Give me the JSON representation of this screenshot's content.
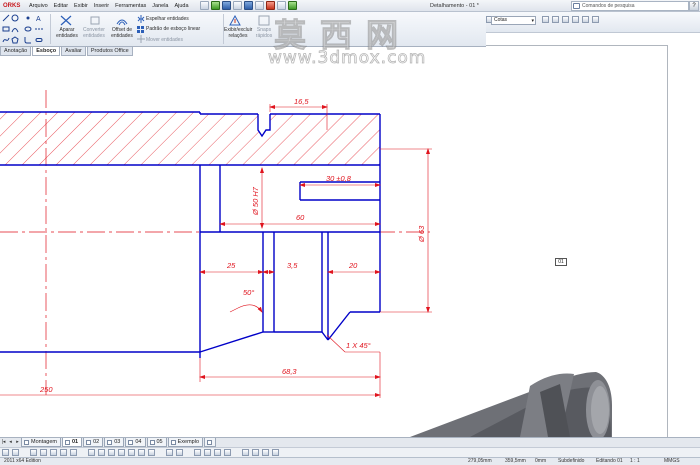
{
  "app": {
    "logo_text": "ORKS",
    "menu": [
      "Arquivo",
      "Editar",
      "Exibir",
      "Inserir",
      "Ferramentas",
      "Janela",
      "Ajuda"
    ],
    "window_title": "Detalhamento - 01 *",
    "search_placeholder": "Comandos de pesquisa",
    "search_go": "?"
  },
  "ribbon": {
    "aparar": "Aparar entidades",
    "converter": "Converter entidades",
    "offset": "Offset de entidades",
    "espelhar": "Espelhar entidades",
    "padrao": "Padrão de esboço linear",
    "mover": "Mover entidades",
    "exibir_relacoes": "Exibir/excluir relações",
    "snaps": "Snaps rápidos",
    "cotas_select": "Cotas"
  },
  "command_tabs": [
    "Anotação",
    "Esboço",
    "Avaliar",
    "Produtos Office"
  ],
  "command_tab_active": 1,
  "watermark": {
    "chinese": "莫西网",
    "url": "www.3dmox.com"
  },
  "drawing": {
    "dimensions": {
      "d_16_5": "16,5",
      "d_30": "30 ±0,8",
      "d_phi50": "Ø 50 H7",
      "d_60": "60",
      "d_phi63": "Ø 63",
      "d_25": "25",
      "d_3_5": "3,5",
      "d_20": "20",
      "d_50deg": "50°",
      "d_chamfer": "1 X 45°",
      "d_68_3": "68,3",
      "d_250": "250"
    },
    "ref_label": "01"
  },
  "sheet_tabs": [
    "Montagem",
    "01",
    "02",
    "03",
    "04",
    "05",
    "Exemplo"
  ],
  "sheet_tab_active": 1,
  "status": {
    "left": "2011 x64 Edition",
    "coords": "279,05mm",
    "coords2": "359,5mm",
    "state": "0mm",
    "mode": "Subdefinido",
    "editing": "Editando 01",
    "scale": "1 : 1",
    "units": "MMGS"
  },
  "colors": {
    "geometry": "#0000c8",
    "dimension": "#e0141e",
    "centerline": "#e0141e",
    "hatch": "#e0141e",
    "part_gray": "#6f7278"
  }
}
